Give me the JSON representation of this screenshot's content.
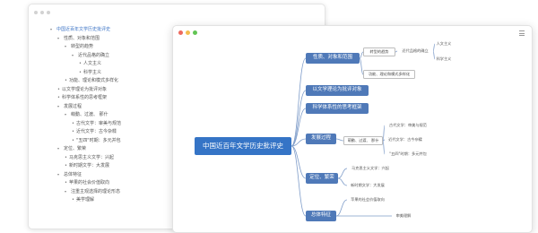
{
  "colors": {
    "accent": "#3574c6",
    "branch": "#4f79b8",
    "link": "#7e9cc9",
    "close": "#ee6a5f",
    "minimize": "#f5be4f",
    "maximize": "#62c554"
  },
  "outline_window": {
    "items": [
      {
        "text": "中国近百年文学历史批评史",
        "level": 0,
        "arrow": true
      },
      {
        "text": "性质、对象和范围",
        "level": 1,
        "arrow": true
      },
      {
        "text": "转型的趋势",
        "level": 2,
        "arrow": true
      },
      {
        "text": "近代品格的确立",
        "level": 3,
        "arrow": true
      },
      {
        "text": "人文主义",
        "level": 4,
        "arrow": false
      },
      {
        "text": "科学主义",
        "level": 4,
        "arrow": false
      },
      {
        "text": "功能、理论和模式多样化",
        "level": 2,
        "arrow": false
      },
      {
        "text": "以文学理论为批评对象",
        "level": 1,
        "arrow": false
      },
      {
        "text": "科学体系性的思考框架",
        "level": 1,
        "arrow": false
      },
      {
        "text": "发展过程",
        "level": 1,
        "arrow": true
      },
      {
        "text": "萌動、过渡、 那什",
        "level": 2,
        "arrow": true
      },
      {
        "text": "古代文学：审美与规范",
        "level": 3,
        "arrow": false
      },
      {
        "text": "近代文学：古今杂糅",
        "level": 3,
        "arrow": false
      },
      {
        "text": "\"五四\"时期：多元并包",
        "level": 3,
        "arrow": false
      },
      {
        "text": "定位、繁荣",
        "level": 1,
        "arrow": true
      },
      {
        "text": "马克思主义文学：兴起",
        "level": 2,
        "arrow": false
      },
      {
        "text": "新时期文学：大发展",
        "level": 2,
        "arrow": false
      },
      {
        "text": "总体特征",
        "level": 1,
        "arrow": true
      },
      {
        "text": "苹果的社会价值取向",
        "level": 2,
        "arrow": false
      },
      {
        "text": "注重主观选择的理论形态",
        "level": 2,
        "arrow": true
      },
      {
        "text": "美学理解",
        "level": 3,
        "arrow": false
      }
    ]
  },
  "mind_map": {
    "root": "中国近百年文学历史批评史",
    "nodes": {
      "n1": "性质、对象和范围",
      "n1a": "转型的趋势",
      "n1a1": "近代品格的确立",
      "n1a1x": "人文主义",
      "n1a1y": "科学主义",
      "n1b": "功能、理论和模式多样化",
      "n2": "以文学理论为批评对象",
      "n3": "科学体系性的思考框架",
      "n4": "发展过程",
      "n4a": "萌動、过渡、 那什",
      "n4a1": "古代文学：审美与规范",
      "n4a2": "近代文学：古今杂糅",
      "n4a3": "\"五四\"时期：多元并包",
      "n5": "定位、繁荣",
      "n5a": "马克思主义文学：兴起",
      "n5b": "新时期文学：大发展",
      "n6": "总体特征",
      "n6a": "苹果的社会价值取向",
      "n6b": "审美理解"
    }
  }
}
